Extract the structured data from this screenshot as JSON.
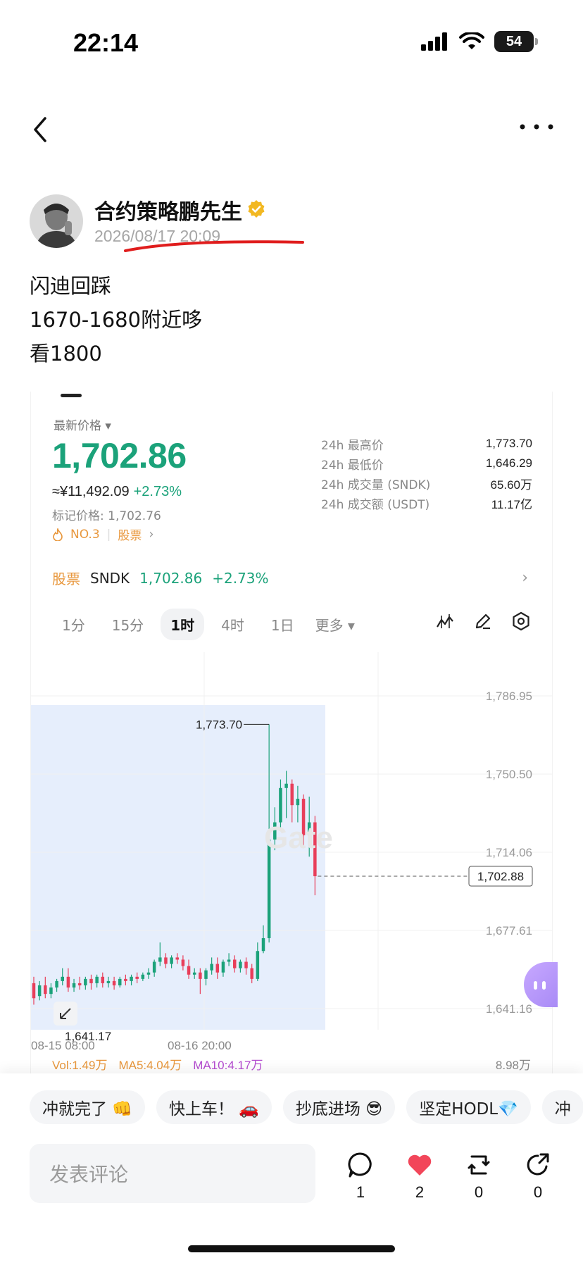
{
  "status_bar": {
    "time": "22:14",
    "battery": "54"
  },
  "author": {
    "name": "合约策略鹏先生",
    "post_time": "2026/08/17 20:09"
  },
  "post": {
    "lines": [
      "闪迪回踩",
      "1670-1680附近哆",
      "看1800"
    ]
  },
  "card": {
    "price_label": "最新价格",
    "price": "1,702.86",
    "price_cny": "≈¥11,492.09",
    "change_pct": "+2.73%",
    "mark_price": "标记价格: 1,702.76",
    "rank": "NO.3",
    "rank_category": "股票",
    "stats": [
      {
        "label": "24h 最高价",
        "value": "1,773.70"
      },
      {
        "label": "24h 最低价",
        "value": "1,646.29"
      },
      {
        "label": "24h 成交量 (SNDK)",
        "value": "65.60万"
      },
      {
        "label": "24h 成交额 (USDT)",
        "value": "11.17亿"
      }
    ],
    "stock_row": {
      "tag": "股票",
      "symbol": "SNDK",
      "price": "1,702.86",
      "change": "+2.73%"
    },
    "timeframes": [
      "1分",
      "15分",
      "1时",
      "4时",
      "1日"
    ],
    "timeframe_active": "1时",
    "more_label": "更多",
    "volume": {
      "vol": "Vol:1.49万",
      "ma5": "MA5:4.04万",
      "ma10": "MA10:4.17万",
      "max": "8.98万"
    },
    "colors": {
      "up": "#1ba27a",
      "down": "#e83e5a",
      "highlight_bg": "#e6eefc"
    }
  },
  "chart_data": {
    "type": "candlestick",
    "y_ticks": [
      "1,786.95",
      "1,750.50",
      "1,714.06",
      "1,677.61",
      "1,641.16"
    ],
    "ylim": [
      1641.16,
      1786.95
    ],
    "x_ticks": [
      "08-15 08:00",
      "08-16 20:00"
    ],
    "high_label": "1,773.70",
    "low_label": "1,641.17",
    "current_price_label": "1,702.88",
    "candles": [
      {
        "o": 1653,
        "h": 1656,
        "c": 1646,
        "l": 1643
      },
      {
        "o": 1647,
        "h": 1654,
        "c": 1652,
        "l": 1645
      },
      {
        "o": 1652,
        "h": 1656,
        "c": 1648,
        "l": 1646
      },
      {
        "o": 1648,
        "h": 1653,
        "c": 1651,
        "l": 1646
      },
      {
        "o": 1651,
        "h": 1655,
        "c": 1654,
        "l": 1649
      },
      {
        "o": 1654,
        "h": 1660,
        "c": 1656,
        "l": 1652
      },
      {
        "o": 1656,
        "h": 1660,
        "c": 1651,
        "l": 1649
      },
      {
        "o": 1651,
        "h": 1655,
        "c": 1653,
        "l": 1649
      },
      {
        "o": 1653,
        "h": 1656,
        "c": 1652,
        "l": 1650
      },
      {
        "o": 1652,
        "h": 1656,
        "c": 1655,
        "l": 1650
      },
      {
        "o": 1655,
        "h": 1657,
        "c": 1653,
        "l": 1650
      },
      {
        "o": 1653,
        "h": 1657,
        "c": 1656,
        "l": 1651
      },
      {
        "o": 1656,
        "h": 1658,
        "c": 1653,
        "l": 1651
      },
      {
        "o": 1653,
        "h": 1656,
        "c": 1654,
        "l": 1651
      },
      {
        "o": 1654,
        "h": 1656,
        "c": 1652,
        "l": 1650
      },
      {
        "o": 1652,
        "h": 1656,
        "c": 1655,
        "l": 1651
      },
      {
        "o": 1655,
        "h": 1657,
        "c": 1654,
        "l": 1652
      },
      {
        "o": 1654,
        "h": 1657,
        "c": 1656,
        "l": 1652
      },
      {
        "o": 1656,
        "h": 1658,
        "c": 1655,
        "l": 1653
      },
      {
        "o": 1655,
        "h": 1658,
        "c": 1657,
        "l": 1654
      },
      {
        "o": 1657,
        "h": 1660,
        "c": 1658,
        "l": 1655
      },
      {
        "o": 1658,
        "h": 1664,
        "c": 1663,
        "l": 1656
      },
      {
        "o": 1663,
        "h": 1672,
        "c": 1665,
        "l": 1661
      },
      {
        "o": 1665,
        "h": 1667,
        "c": 1662,
        "l": 1660
      },
      {
        "o": 1662,
        "h": 1666,
        "c": 1665,
        "l": 1660
      },
      {
        "o": 1665,
        "h": 1667,
        "c": 1664,
        "l": 1662
      },
      {
        "o": 1664,
        "h": 1666,
        "c": 1661,
        "l": 1659
      },
      {
        "o": 1661,
        "h": 1664,
        "c": 1657,
        "l": 1655
      },
      {
        "o": 1657,
        "h": 1660,
        "c": 1658,
        "l": 1655
      },
      {
        "o": 1658,
        "h": 1660,
        "c": 1655,
        "l": 1648
      },
      {
        "o": 1655,
        "h": 1660,
        "c": 1659,
        "l": 1652
      },
      {
        "o": 1659,
        "h": 1665,
        "c": 1662,
        "l": 1657
      },
      {
        "o": 1662,
        "h": 1665,
        "c": 1658,
        "l": 1655
      },
      {
        "o": 1658,
        "h": 1664,
        "c": 1663,
        "l": 1656
      },
      {
        "o": 1663,
        "h": 1667,
        "c": 1664,
        "l": 1661
      },
      {
        "o": 1664,
        "h": 1666,
        "c": 1660,
        "l": 1658
      },
      {
        "o": 1660,
        "h": 1664,
        "c": 1663,
        "l": 1658
      },
      {
        "o": 1663,
        "h": 1665,
        "c": 1660,
        "l": 1657
      },
      {
        "o": 1660,
        "h": 1662,
        "c": 1655,
        "l": 1653
      },
      {
        "o": 1655,
        "h": 1672,
        "c": 1668,
        "l": 1654
      },
      {
        "o": 1668,
        "h": 1680,
        "c": 1674,
        "l": 1667
      },
      {
        "o": 1674,
        "h": 1773.7,
        "c": 1720,
        "l": 1672
      },
      {
        "o": 1720,
        "h": 1735,
        "c": 1728,
        "l": 1715
      },
      {
        "o": 1728,
        "h": 1748,
        "c": 1744,
        "l": 1724
      },
      {
        "o": 1744,
        "h": 1752,
        "c": 1746,
        "l": 1730
      },
      {
        "o": 1746,
        "h": 1748,
        "c": 1736,
        "l": 1728
      },
      {
        "o": 1736,
        "h": 1745,
        "c": 1739,
        "l": 1728
      },
      {
        "o": 1739,
        "h": 1741,
        "c": 1722,
        "l": 1716
      },
      {
        "o": 1722,
        "h": 1740,
        "c": 1728,
        "l": 1712
      },
      {
        "o": 1728,
        "h": 1731,
        "c": 1702.88,
        "l": 1694
      }
    ]
  },
  "bottom": {
    "chips": [
      "冲就完了 👊",
      "快上车！ 🚗",
      "抄底进场 😎",
      "坚定HODL💎",
      "冲"
    ],
    "comment_placeholder": "发表评论",
    "actions": [
      {
        "name": "comment",
        "count": "1"
      },
      {
        "name": "like",
        "count": "2"
      },
      {
        "name": "repost",
        "count": "0"
      },
      {
        "name": "share",
        "count": "0"
      }
    ]
  }
}
